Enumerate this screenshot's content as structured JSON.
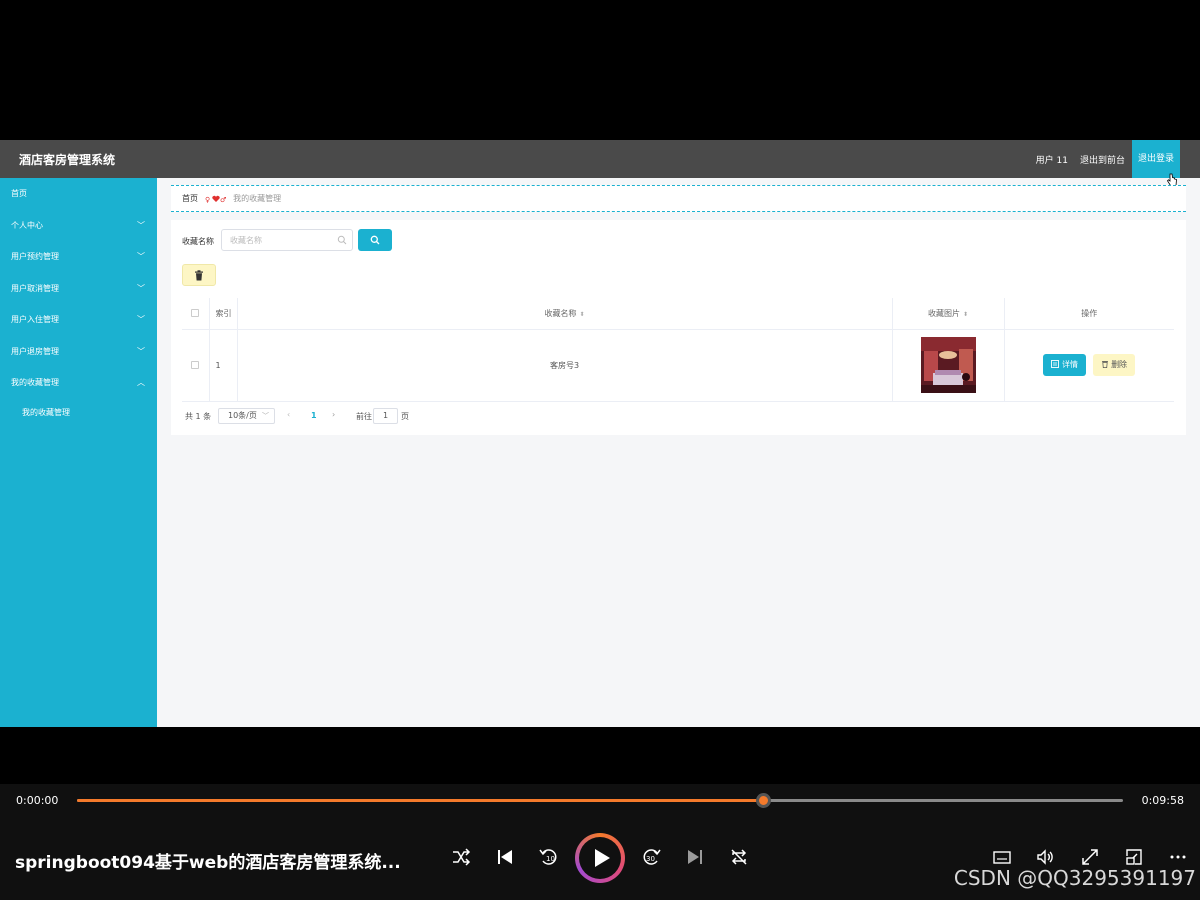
{
  "app": {
    "title": "酒店客房管理系统",
    "user": "用户 11",
    "to_front": "退出到前台",
    "logout": "退出登录"
  },
  "sidebar": {
    "items": [
      {
        "label": "首页",
        "chevron": ""
      },
      {
        "label": "个人中心",
        "chevron": "﹀"
      },
      {
        "label": "用户预约管理",
        "chevron": "﹀"
      },
      {
        "label": "用户取消管理",
        "chevron": "﹀"
      },
      {
        "label": "用户入住管理",
        "chevron": "﹀"
      },
      {
        "label": "用户退房管理",
        "chevron": "﹀"
      },
      {
        "label": "我的收藏管理",
        "chevron": "︿"
      }
    ],
    "submenu": [
      "我的收藏管理"
    ]
  },
  "breadcrumb": {
    "home": "首页",
    "current": "我的收藏管理"
  },
  "search": {
    "label": "收藏名称",
    "placeholder": "收藏名称"
  },
  "table": {
    "headers": {
      "index": "索引",
      "name": "收藏名称",
      "image": "收藏图片",
      "actions": "操作"
    },
    "rows": [
      {
        "index": "1",
        "name": "客房号3"
      }
    ],
    "detail_label": "详情",
    "delete_label": "删除"
  },
  "pagination": {
    "total": "共 1 条",
    "page_size": "10条/页",
    "current": "1",
    "goto_label": "前往",
    "goto_value": "1",
    "unit": "页"
  },
  "player": {
    "time_current": "0:00:00",
    "time_total": "0:09:58",
    "progress": 0.656,
    "title": "springboot094基于web的酒店客房管理系统...",
    "watermark": "CSDN @QQ3295391197",
    "accent": "#f47a2b"
  },
  "colors": {
    "primary": "#1bb1d0",
    "topbar": "#4a4a4a",
    "warning_bg": "#fdf6c5"
  }
}
